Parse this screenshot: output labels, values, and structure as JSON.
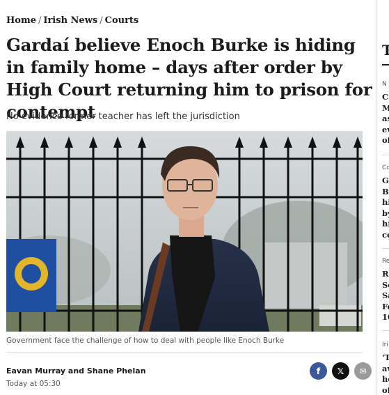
{
  "breadcrumb": {
    "items": [
      "Home",
      "Irish News",
      "Courts"
    ],
    "separator": "/"
  },
  "article": {
    "headline": "Gardaí believe Enoch Burke is hiding in family home – days after order by High Court returning him to prison for contempt",
    "standfirst": "No evidence former teacher has left the jurisdiction",
    "image_caption": "Government face the challenge of how to deal with people like Enoch Burke",
    "authors": "Eavan Murray and Shane Phelan",
    "published": "Today at 05:30"
  },
  "share": {
    "facebook_icon": "facebook-icon",
    "x_icon": "x-icon",
    "email_icon": "email-icon",
    "facebook_glyph": "f",
    "x_glyph": "𝕏",
    "mail_glyph": "✉"
  },
  "sidebar": {
    "title": "T",
    "items": [
      {
        "category": "N",
        "lines": [
          "C",
          "M",
          "as",
          "ev",
          "of"
        ]
      },
      {
        "category": "Co",
        "lines": [
          "G",
          "B",
          "hi",
          "by",
          "hi",
          "co"
        ]
      },
      {
        "category": "Re",
        "lines": [
          "R",
          "Sc",
          "Sa",
          "Fe",
          "10"
        ]
      },
      {
        "category": "Iri",
        "lines": [
          "'T",
          "av",
          "he",
          "of"
        ]
      }
    ]
  },
  "colors": {
    "facebook": "#3b5998",
    "x": "#111111",
    "email": "#9a9a9a",
    "text": "#1b1b1b",
    "muted": "#555555"
  }
}
